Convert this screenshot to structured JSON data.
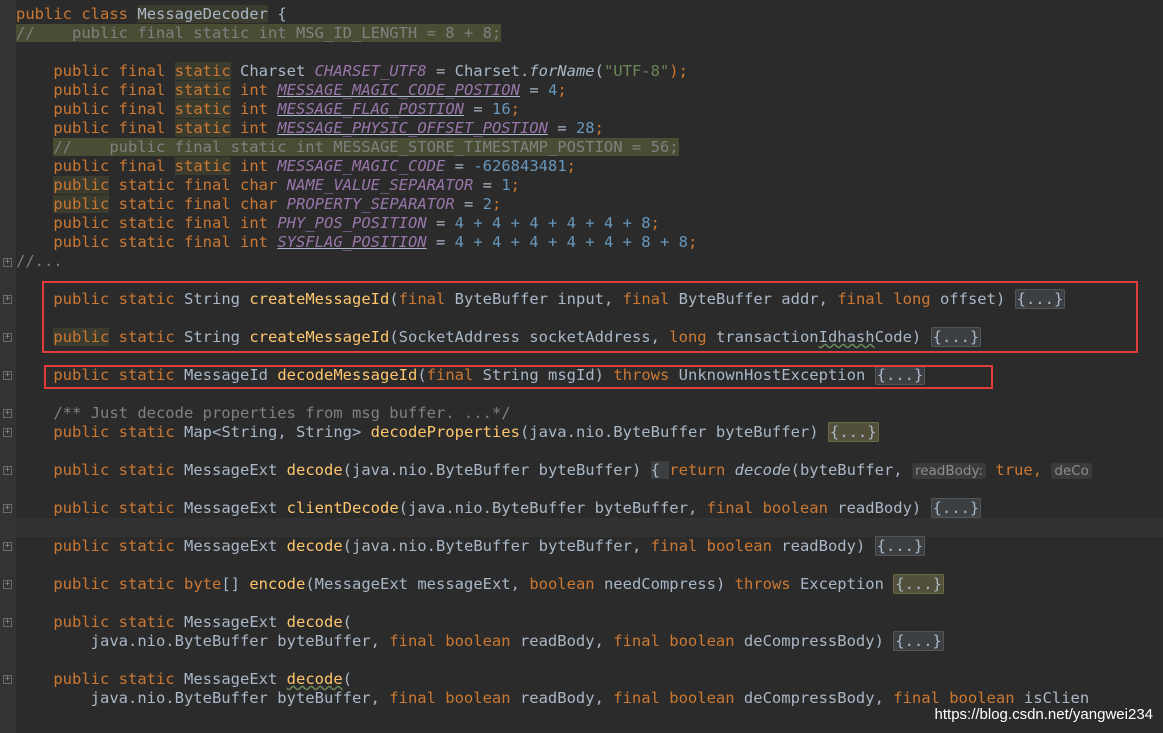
{
  "editor": {
    "language": "Java",
    "theme_colors": {
      "background": "#2b2b2b",
      "keyword": "#cc7832",
      "function": "#ffc66d",
      "constant": "#9876aa",
      "number": "#6897bb",
      "string": "#6a8759",
      "comment": "#808080",
      "highlight_box": "#e03c3c"
    }
  },
  "code": {
    "l1_public": "public",
    "l1_class": "class",
    "l1_name": "MessageDecoder",
    "l1_brace": " {",
    "l2": "//    public final static int MSG_ID_LENGTH = 8 + 8;",
    "l4_mods": "public final",
    "l4_static": "static",
    "l4_type": " Charset ",
    "l4_const": "CHARSET_UTF8",
    "l4_eq": " = Charset.",
    "l4_call": "forName",
    "l4_open": "(",
    "l4_str": "\"UTF-8\"",
    "l4_end": ");",
    "l5_const": "MESSAGE_MAGIC_CODE_POSTION",
    "l5_val": "4",
    "l6_const": "MESSAGE_FLAG_POSTION",
    "l6_val": "16",
    "l7_const": "MESSAGE_PHYSIC_OFFSET_POSTION",
    "l7_val": "28",
    "l8": "//    public final static int MESSAGE_STORE_TIMESTAMP_POSTION = 56;",
    "l9_const": "MESSAGE_MAGIC_CODE",
    "l9_val": "-626843481",
    "l10_const": "NAME_VALUE_SEPARATOR",
    "l10_val": "1",
    "l11_const": "PROPERTY_SEPARATOR",
    "l11_val": "2",
    "l12_const": "PHY_POS_POSITION",
    "l12_expr": "4 + 4 + 4 + 4 + 4 + 8",
    "l13_const": "SYSFLAG_POSITION",
    "l13_expr": "4 + 4 + 4 + 4 + 4 + 8 + 8",
    "l14": "//...",
    "l16_fn": "createMessageId",
    "l16_params_a": "(",
    "l16_p1": "final",
    "l16_p2": " ByteBuffer input, ",
    "l16_p3": "final",
    "l16_p4": " ByteBuffer addr, ",
    "l16_p5": "final long",
    "l16_p6": " offset) ",
    "l18_fn": "createMessageId",
    "l18_params": "(SocketAddress socketAddress, ",
    "l18_long": "long",
    "l18_param2a": " transaction",
    "l18_param2b": "Idhash",
    "l18_param2c": "Code) ",
    "l20_type": "MessageId ",
    "l20_fn": "decodeMessageId",
    "l20_open": "(",
    "l20_final": "final",
    "l20_param": " String msgId) ",
    "l20_throws": "throws",
    "l20_exc": " UnknownHostException ",
    "l22": "/** Just decode properties from msg buffer. ...*/",
    "l23_type": "Map<String, String> ",
    "l23_fn": "decodeProperties",
    "l23_param": "(java.nio.ByteBuffer byteBuffer) ",
    "l25_type": "MessageExt ",
    "l25_fn": "decode",
    "l25_param": "(java.nio.ByteBuffer byteBuffer) ",
    "l25_brace": "{ ",
    "l25_return": "return",
    "l25_call": "decode",
    "l25_args": "(byteBuffer, ",
    "l25_hint1": "readBody:",
    "l25_true": "true",
    "l25_comma": ", ",
    "l25_hint2": "deCo",
    "l27_fn": "clientDecode",
    "l27_param": "(java.nio.ByteBuffer byteBuffer, ",
    "l27_fb": "final boolean",
    "l27_rb": " readBody) ",
    "l29_fn": "decode",
    "l29_param": "(java.nio.ByteBuffer byteBuffer, ",
    "l29_fb": "final boolean",
    "l29_rb": " readBody) ",
    "l31_type": "byte",
    "l31_arr": "[] ",
    "l31_fn": "encode",
    "l31_param": "(MessageExt messageExt, ",
    "l31_bool": "boolean",
    "l31_param2": " needCompress) ",
    "l31_throws": "throws",
    "l31_exc": " Exception ",
    "l33_fn": "decode",
    "l33_open": "(",
    "l34_a": "    java.nio.ByteBuffer byteBuffer, ",
    "l34_fb1": "final boolean",
    "l34_b": " readBody, ",
    "l34_fb2": "final boolean",
    "l34_c": " deCompressBody) ",
    "l36_fn": "decode",
    "l37_c": " deCompressBody, ",
    "l37_fb3": "final boolean",
    "l37_d": " isClien",
    "kw_public": "public",
    "kw_static": "static",
    "kw_final": "final",
    "kw_public_final": "public final",
    "kw_static_final": "static final",
    "kw_int": "int",
    "kw_char": "char",
    "t_string": "String ",
    "t_messageext": "MessageExt ",
    "eq": " = ",
    "semi": ";",
    "fold": "{...}"
  },
  "watermark": "https://blog.csdn.net/yangwei234"
}
